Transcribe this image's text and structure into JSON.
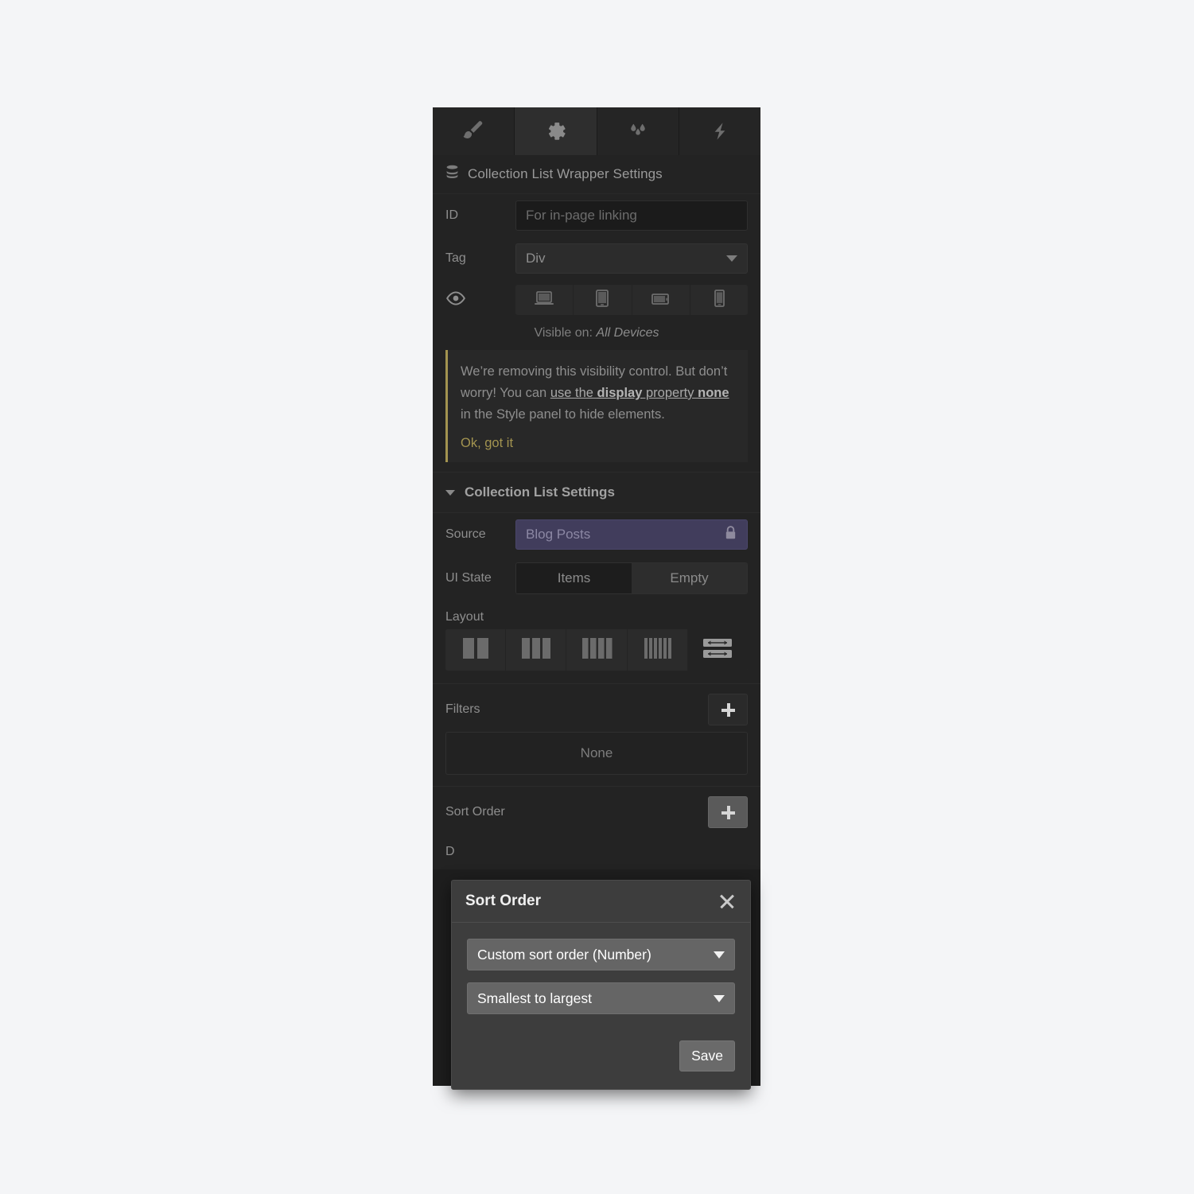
{
  "tabs": [
    {
      "name": "style-tab",
      "icon": "paintbrush-icon",
      "active": false
    },
    {
      "name": "settings-tab",
      "icon": "gear-icon",
      "active": true
    },
    {
      "name": "assets-tab",
      "icon": "water-drops-icon",
      "active": false
    },
    {
      "name": "interactions-tab",
      "icon": "lightning-bolt-icon",
      "active": false
    }
  ],
  "header": {
    "icon": "database-stack-icon",
    "title": "Collection List Wrapper Settings"
  },
  "id_field": {
    "label": "ID",
    "placeholder": "For in-page linking",
    "value": ""
  },
  "tag_field": {
    "label": "Tag",
    "value": "Div"
  },
  "visibility": {
    "eye_icon": "eye-icon",
    "devices": [
      {
        "name": "device-desktop",
        "icon": "laptop-icon"
      },
      {
        "name": "device-tablet",
        "icon": "tablet-portrait-icon"
      },
      {
        "name": "device-tablet-landscape",
        "icon": "tablet-landscape-icon"
      },
      {
        "name": "device-mobile",
        "icon": "mobile-icon"
      }
    ],
    "visible_on_prefix": "Visible on:",
    "visible_on_value": "All Devices"
  },
  "notice": {
    "line1": "We’re removing this visibility control.",
    "line2_pre": "But don’t worry! You can ",
    "link_part1": "use the ",
    "link_bold1": "display",
    "link_mid": " property ",
    "link_bold2": "none",
    "line3_post": " in the Style panel to hide elements.",
    "dismiss": "Ok, got it",
    "accent_color": "#a39450"
  },
  "collection_section": {
    "title": "Collection List Settings",
    "collapse_icon": "triangle-down-icon"
  },
  "source": {
    "label": "Source",
    "value": "Blog Posts",
    "lock_icon": "lock-icon",
    "accent_color": "#413d5c"
  },
  "ui_state": {
    "label": "UI State",
    "options": [
      {
        "label": "Items",
        "selected": true
      },
      {
        "label": "Empty",
        "selected": false
      }
    ]
  },
  "layout": {
    "label": "Layout",
    "options": [
      {
        "name": "layout-2-col",
        "icon": "two-column-icon",
        "bars": 2,
        "selected": false
      },
      {
        "name": "layout-3-col",
        "icon": "three-column-icon",
        "bars": 3,
        "selected": false
      },
      {
        "name": "layout-4-col",
        "icon": "four-column-icon",
        "bars": 4,
        "selected": false
      },
      {
        "name": "layout-6-col",
        "icon": "six-column-icon",
        "bars": 6,
        "selected": false
      },
      {
        "name": "layout-fluid",
        "icon": "fluid-rows-icon",
        "bars": 0,
        "selected": true
      }
    ]
  },
  "filters": {
    "label": "Filters",
    "add_icon": "plus-icon",
    "empty_value": "None"
  },
  "sort_order": {
    "label": "Sort Order",
    "add_icon": "plus-icon",
    "add_active": true,
    "obscured_row_text": "D"
  },
  "modal": {
    "title": "Sort Order",
    "close_icon": "close-icon",
    "field_label": "Custom sort order (Number)",
    "direction_label": "Smallest to largest",
    "save_label": "Save"
  }
}
